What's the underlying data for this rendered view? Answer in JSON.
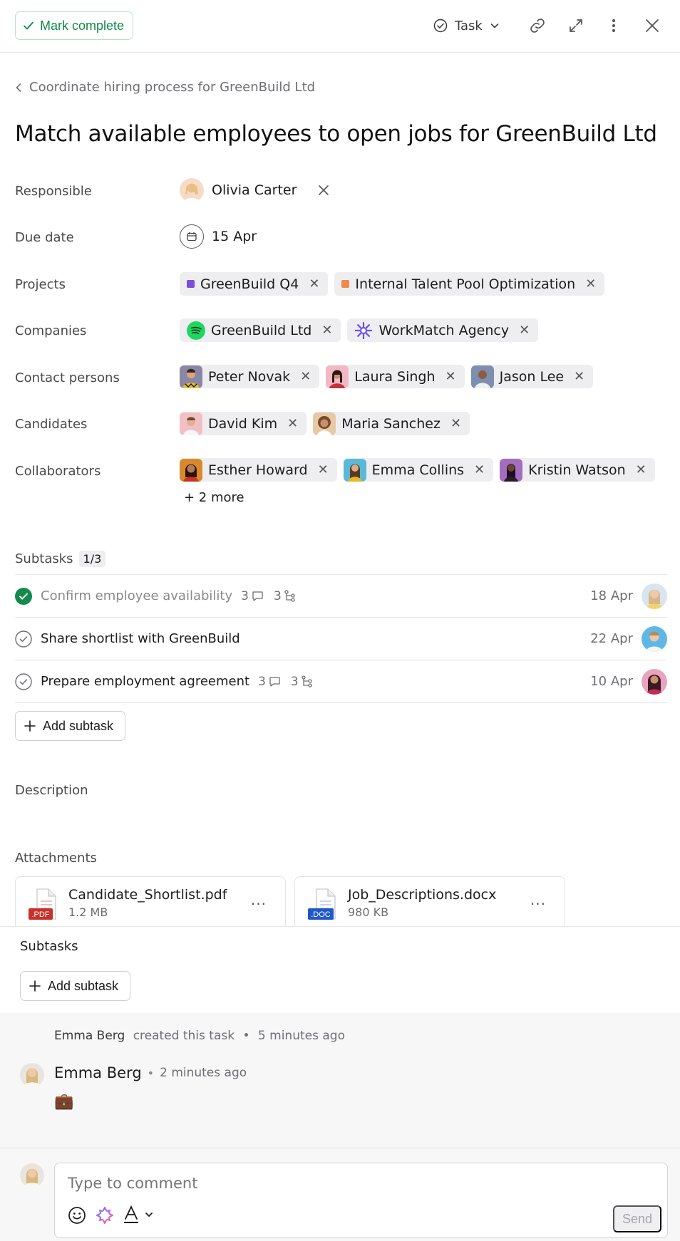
{
  "toolbar": {
    "mark_complete": "Mark complete",
    "task_type": "Task"
  },
  "breadcrumb": "Coordinate hiring process for GreenBuild Ltd",
  "title": "Match available employees to open jobs for GreenBuild Ltd",
  "fields": {
    "responsible_label": "Responsible",
    "responsible": "Olivia Carter",
    "due_label": "Due date",
    "due": "15 Apr",
    "projects_label": "Projects",
    "projects": [
      "GreenBuild Q4",
      "Internal Talent Pool Optimization"
    ],
    "project_colors": [
      "#7b4fd6",
      "#f08a4b"
    ],
    "companies_label": "Companies",
    "companies": [
      "GreenBuild Ltd",
      "WorkMatch Agency"
    ],
    "contacts_label": "Contact persons",
    "contacts": [
      "Peter Novak",
      "Laura Singh",
      "Jason Lee"
    ],
    "candidates_label": "Candidates",
    "candidates": [
      "David Kim",
      "Maria Sanchez"
    ],
    "collaborators_label": "Collaborators",
    "collaborators": [
      "Esther Howard",
      "Emma Collins",
      "Kristin Watson"
    ],
    "collaborators_more": "+ 2 more"
  },
  "subtasks": {
    "label": "Subtasks",
    "count": "1/3",
    "items": [
      {
        "name": "Confirm employee availability",
        "comments": "3",
        "subitems": "3",
        "date": "18 Apr",
        "done": true
      },
      {
        "name": "Share shortlist with GreenBuild",
        "date": "22 Apr",
        "done": false
      },
      {
        "name": "Prepare employment agreement",
        "comments": "3",
        "subitems": "3",
        "date": "10 Apr",
        "done": false
      }
    ],
    "add_label": "Add subtask"
  },
  "description_label": "Description",
  "attachments": {
    "label": "Attachments",
    "files": [
      {
        "name": "Candidate_Shortlist.pdf",
        "size": "1.2 MB",
        "ext": ".PDF"
      },
      {
        "name": "Job_Descriptions.docx",
        "size": "980 KB",
        "ext": ".DOC"
      }
    ]
  },
  "subtasks2": {
    "label": "Subtasks",
    "add_label": "Add subtask"
  },
  "activity": {
    "creator": "Emma Berg",
    "created_text": "created this task",
    "created_time": "5 minutes ago",
    "comment_author": "Emma Berg",
    "comment_time": "2 minutes ago",
    "comment_body": "💼"
  },
  "composer": {
    "placeholder": "Type to comment",
    "send": "Send"
  }
}
